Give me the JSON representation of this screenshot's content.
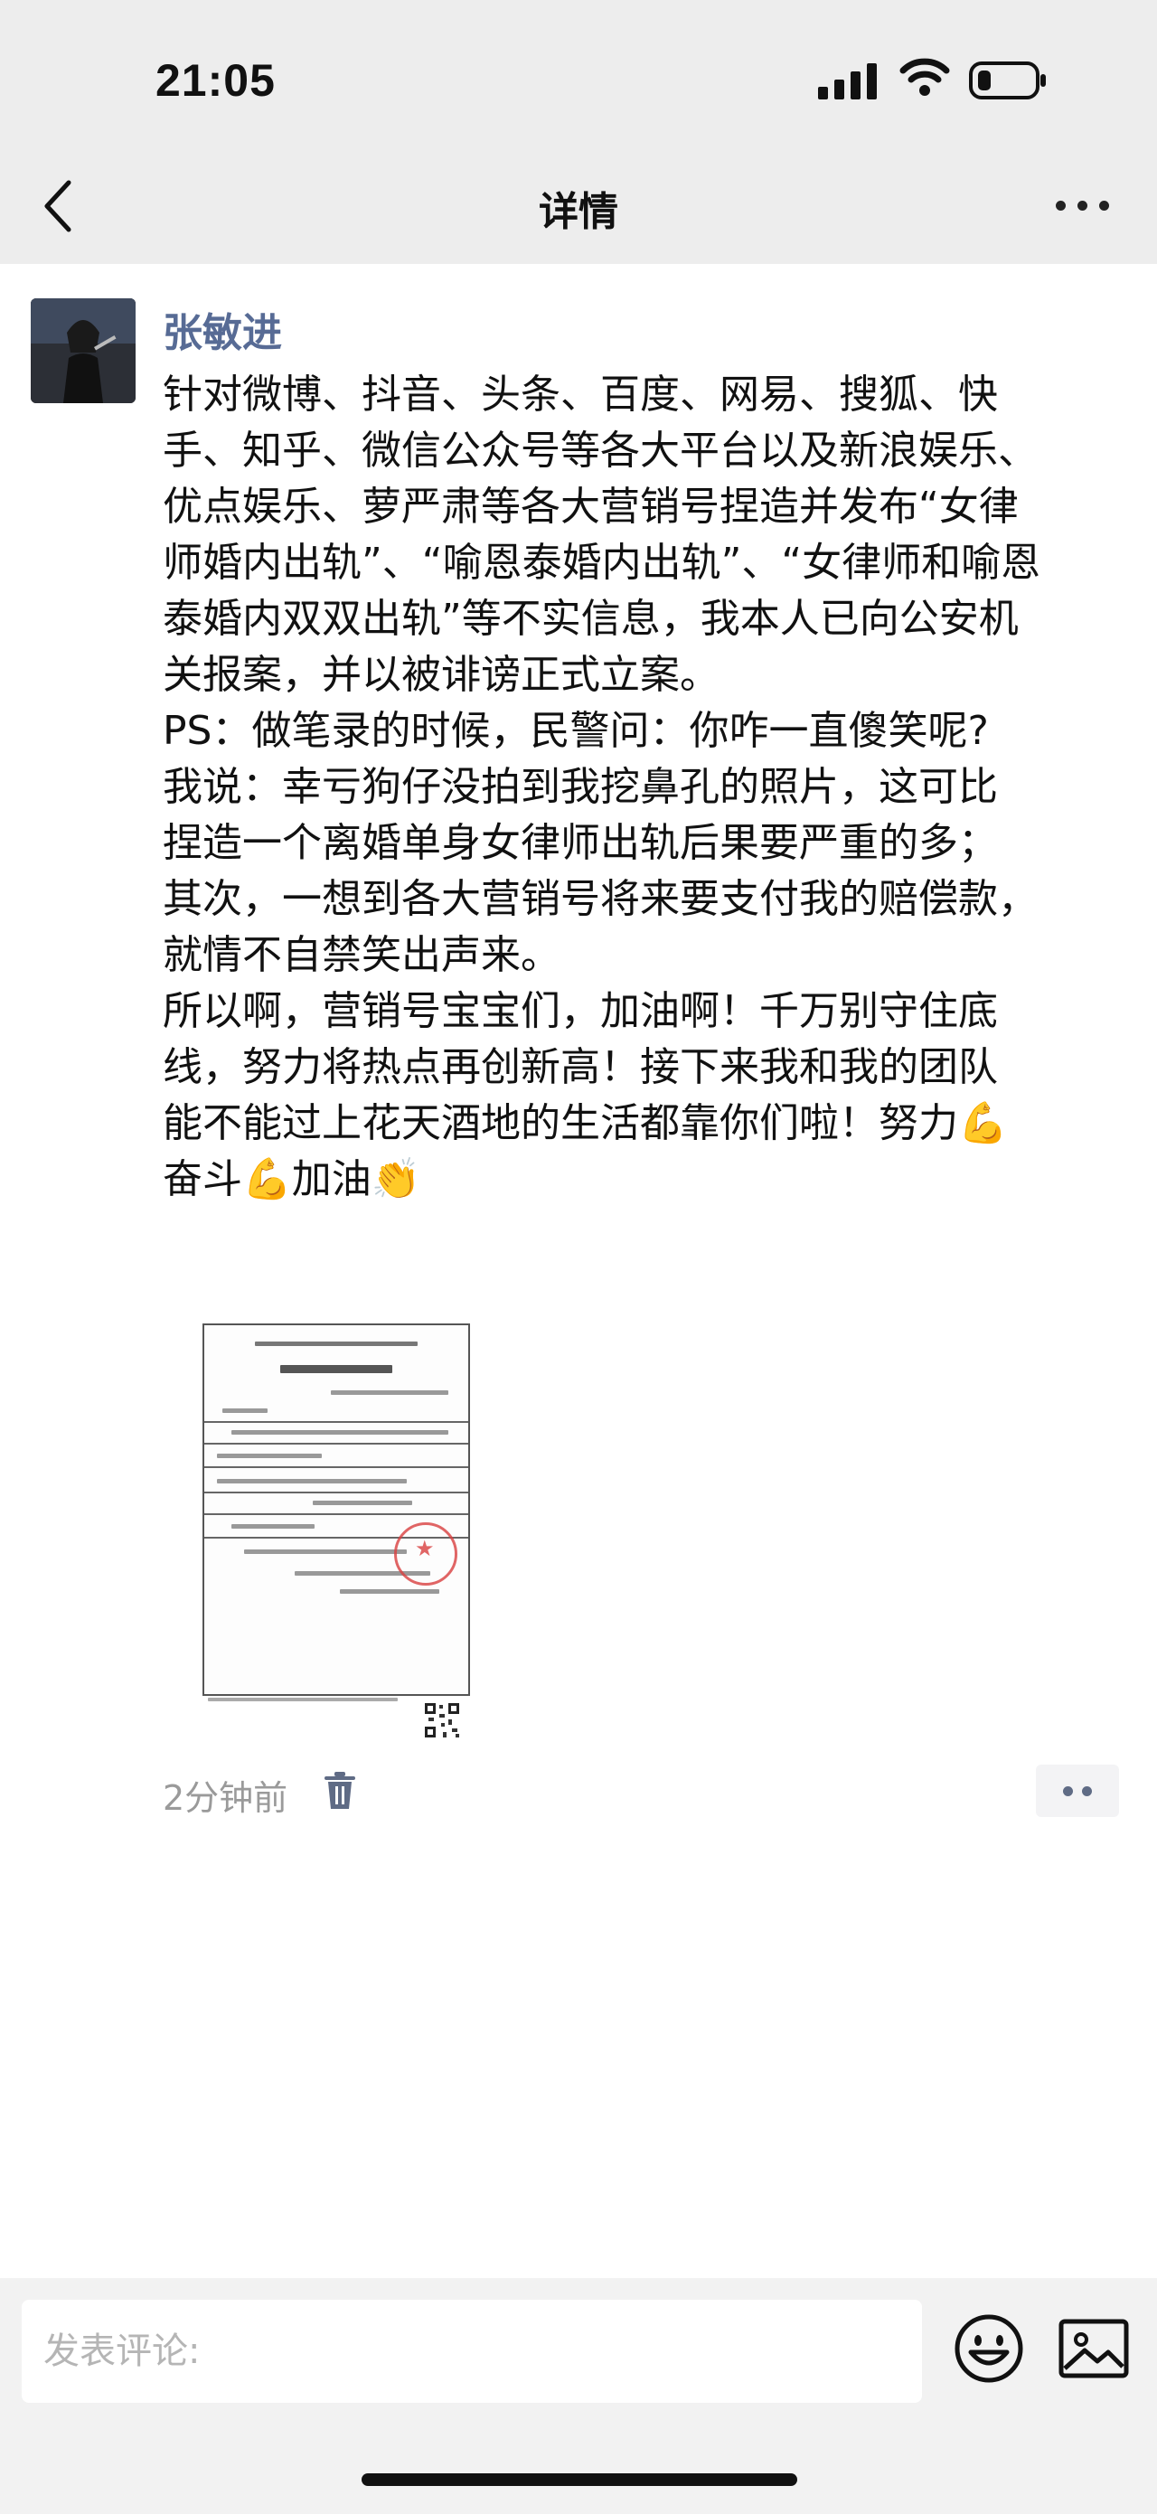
{
  "status_bar": {
    "time": "21:05"
  },
  "nav": {
    "title": "详情"
  },
  "post": {
    "author": "张敏进",
    "lines": [
      "针对微博、抖音、头条、百度、网易、搜狐、快",
      "手、知乎、微信公众号等各大平台以及新浪娱乐、",
      "优点娱乐、萝严肃等各大营销号捏造并发布“女律",
      "师婚内出轨”、“喻恩泰婚内出轨”、“女律师和喻恩",
      "泰婚内双双出轨”等不实信息，我本人已向公安机",
      "关报案，并以被诽谤正式立案。",
      "PS：做笔录的时候，民警问：你咋一直傻笑呢?",
      "我说：幸亏狗仔没拍到我挖鼻孔的照片，这可比",
      "捏造一个离婚单身女律师出轨后果要严重的多；",
      "其次，一想到各大营销号将来要支付我的赔偿款，",
      "就情不自禁笑出声来。",
      "所以啊，营销号宝宝们，加油啊！千万别守住底",
      "线，努力将热点再创新高！接下来我和我的团队",
      "能不能过上花天酒地的生活都靠你们啦！努力💪",
      "奋斗💪加油👏"
    ],
    "timestamp": "2分钟前"
  },
  "comment_bar": {
    "placeholder": "发表评论:"
  },
  "icons": {
    "back": "chevron-left-icon",
    "more": "more-icon",
    "delete": "trash-icon",
    "comment_more": "more-dots-icon",
    "emoji": "smiley-icon",
    "image": "image-icon"
  },
  "colors": {
    "author": "#576b95",
    "header_bg": "#ededed",
    "muted": "#9a9a9a"
  }
}
